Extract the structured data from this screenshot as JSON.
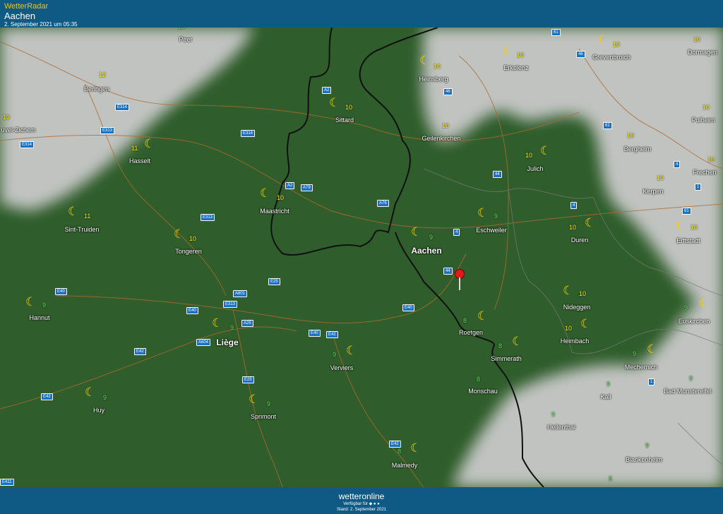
{
  "header": {
    "app_name": "WetterRadar",
    "location": "Aachen",
    "timestamp": "2. September 2021 um 05:35"
  },
  "footer": {
    "brand": "wetteronline",
    "available": "Verfügbar für",
    "stand": "Stand: 2. September 2021"
  },
  "colors": {
    "header_bg": "#0f5a85",
    "app_name": "#f5c400",
    "temp_yellow": "#f5e600",
    "temp_green": "#5fe05f",
    "moon": "#f5d000",
    "pin": "#e01a1a"
  },
  "cities": [
    {
      "name": "Peer",
      "temp": "10",
      "icon": "moon-icon"
    },
    {
      "name": "Beringen",
      "temp": "12",
      "icon": "none"
    },
    {
      "name": "uvel-Zichem",
      "temp": "13",
      "icon": "none"
    },
    {
      "name": "Hasselt",
      "temp": "11",
      "icon": "moon-icon"
    },
    {
      "name": "Sittard",
      "temp": "10",
      "icon": "moon-icon"
    },
    {
      "name": "Heinsberg",
      "temp": "10",
      "icon": "moon-icon"
    },
    {
      "name": "Erkelenz",
      "temp": "10",
      "icon": "moon-icon"
    },
    {
      "name": "Grevenbroich",
      "temp": "10",
      "icon": "moon-icon"
    },
    {
      "name": "Dormagen",
      "temp": "10",
      "icon": "none"
    },
    {
      "name": "Pulheim",
      "temp": "10",
      "icon": "none"
    },
    {
      "name": "Geilenkirchen",
      "temp": "10",
      "icon": "none"
    },
    {
      "name": "Bergheim",
      "temp": "10",
      "icon": "none"
    },
    {
      "name": "Julich",
      "temp": "10",
      "icon": "moon-icon"
    },
    {
      "name": "Frechen",
      "temp": "10",
      "icon": "none"
    },
    {
      "name": "Kerpen",
      "temp": "10",
      "icon": "none"
    },
    {
      "name": "Maastricht",
      "temp": "10",
      "icon": "moon-icon"
    },
    {
      "name": "Sint-Truiden",
      "temp": "11",
      "icon": "moon-icon"
    },
    {
      "name": "Tongeren",
      "temp": "10",
      "icon": "moon-icon"
    },
    {
      "name": "Aachen",
      "temp": "9",
      "icon": "moon-icon"
    },
    {
      "name": "Eschweiler",
      "temp": "9",
      "icon": "moon-icon"
    },
    {
      "name": "Duren",
      "temp": "10",
      "icon": "moon-icon"
    },
    {
      "name": "Erftstadt",
      "temp": "10",
      "icon": "moon-icon"
    },
    {
      "name": "Hannut",
      "temp": "9",
      "icon": "moon-icon"
    },
    {
      "name": "Nideggen",
      "temp": "10",
      "icon": "moon-icon"
    },
    {
      "name": "Euskirchen",
      "temp": "9",
      "icon": "moon-icon"
    },
    {
      "name": "Liège",
      "temp": "9",
      "icon": "moon-icon"
    },
    {
      "name": "Verviers",
      "temp": "9",
      "icon": "moon-icon"
    },
    {
      "name": "Roetgen",
      "temp": "8",
      "icon": "moon-icon"
    },
    {
      "name": "Heimbach",
      "temp": "10",
      "icon": "moon-icon"
    },
    {
      "name": "Simmerath",
      "temp": "8",
      "icon": "moon-icon"
    },
    {
      "name": "Mechernich",
      "temp": "9",
      "icon": "moon-icon"
    },
    {
      "name": "Monschau",
      "temp": "8",
      "icon": "none"
    },
    {
      "name": "Kall",
      "temp": "9",
      "icon": "none"
    },
    {
      "name": "Bad Munstereifel",
      "temp": "9",
      "icon": "none"
    },
    {
      "name": "Huy",
      "temp": "9",
      "icon": "moon-icon"
    },
    {
      "name": "Sprimont",
      "temp": "9",
      "icon": "moon-icon"
    },
    {
      "name": "Hellenthal",
      "temp": "9",
      "icon": "none"
    },
    {
      "name": "Malmedy",
      "temp": "8",
      "icon": "moon-icon"
    },
    {
      "name": "Blankenheim",
      "temp": "9",
      "icon": "none"
    },
    {
      "name": "",
      "temp": "8",
      "icon": "none"
    }
  ],
  "roads": [
    "61",
    "46",
    "A2",
    "E314",
    "E313",
    "E314",
    "46",
    "E314",
    "A2",
    "A79",
    "61",
    "44",
    "4",
    "A76",
    "E313",
    "4",
    "61",
    "4",
    "1",
    "44",
    "A601",
    "E25",
    "E313",
    "E40",
    "E40",
    "E40",
    "A25",
    "A604",
    "E40",
    "E42",
    "E42",
    "E25",
    "E42",
    "1",
    "E42",
    "E411"
  ]
}
